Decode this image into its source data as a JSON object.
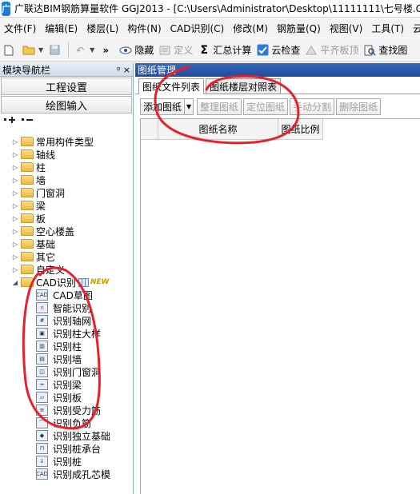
{
  "window": {
    "title": "广联达BIM钢筋算量软件 GGJ2013 - [C:\\Users\\Administrator\\Desktop\\11111111\\七号楼.G"
  },
  "menu": [
    "文件(F)",
    "编辑(E)",
    "楼层(L)",
    "构件(N)",
    "CAD识别(C)",
    "修改(M)",
    "钢筋量(Q)",
    "视图(V)",
    "工具(T)",
    "云应用"
  ],
  "toolbar": {
    "hide_label": "隐藏",
    "define_label": "定义",
    "sum_label": "汇总计算",
    "cloud_check_label": "云检查",
    "flatten_label": "平齐板顶",
    "find_label": "查找图"
  },
  "left_panel": {
    "title": "模块导航栏",
    "pin": "ᵖ",
    "close": "×",
    "project_settings": "工程设置",
    "drawing_input": "绘图输入",
    "categories": [
      "常用构件类型",
      "轴线",
      "柱",
      "墙",
      "门窗洞",
      "梁",
      "板",
      "空心楼盖",
      "基础",
      "其它",
      "自定义"
    ],
    "cad_group": "CAD识别",
    "new_badge": "NEW",
    "cad_children": [
      "CAD草图",
      "智能识别",
      "识别轴网",
      "识别柱大样",
      "识别柱",
      "识别墙",
      "识别门窗洞",
      "识别梁",
      "识别板",
      "识别受力筋",
      "识别负筋",
      "识别独立基础",
      "识别桩承台",
      "识别桩",
      "识别成孔芯模"
    ]
  },
  "right_panel": {
    "title": "图纸管理",
    "tabs": [
      "图纸文件列表",
      "图纸楼层对照表"
    ],
    "actions": {
      "add": "添加图纸",
      "organize": "整理图纸",
      "locate": "定位图纸",
      "split": "手动分割",
      "delete": "删除图纸"
    },
    "columns": [
      "图纸名称",
      "图纸比例"
    ]
  },
  "colors": {
    "annotation": "#e8202a",
    "panel_title": "#1f4c9c"
  }
}
